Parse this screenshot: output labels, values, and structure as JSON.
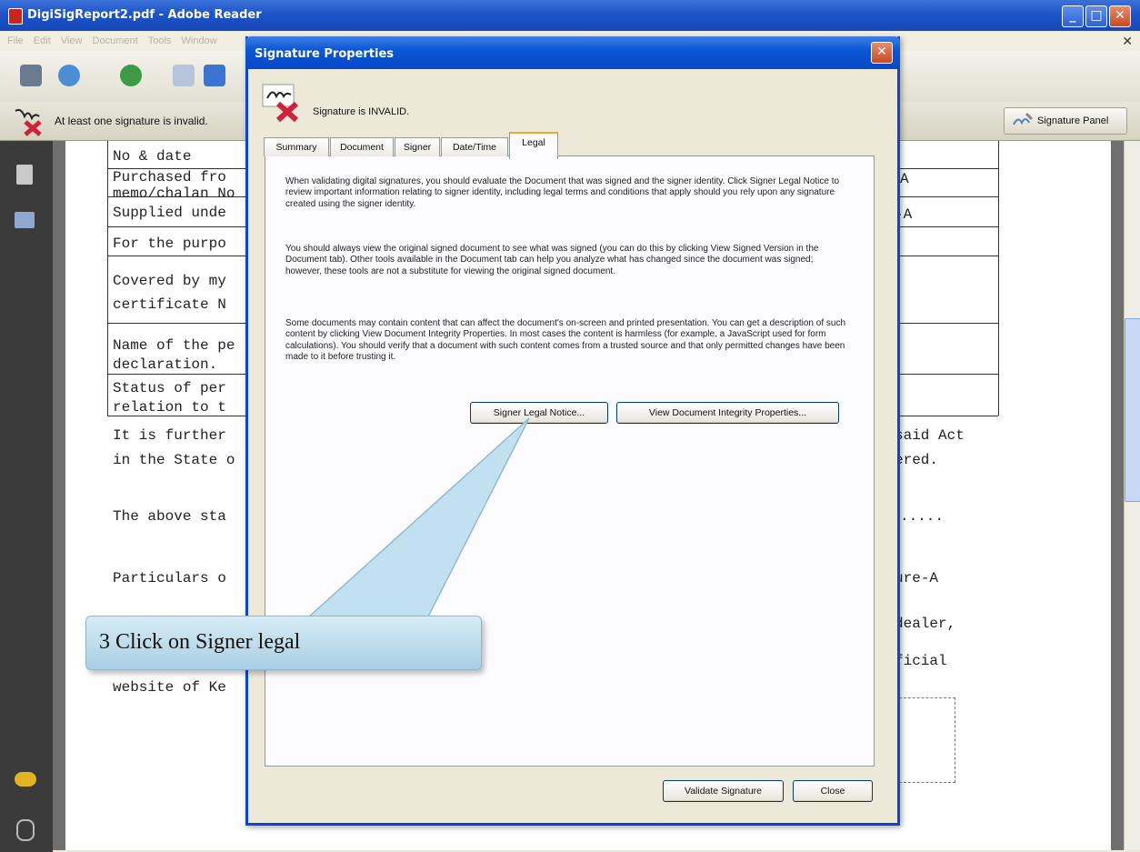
{
  "window": {
    "title": "DigiSigReport2.pdf - Adobe Reader",
    "menu": [
      "File",
      "Edit",
      "View",
      "Document",
      "Tools",
      "Window"
    ]
  },
  "sigbar": {
    "message": "At least one signature is invalid.",
    "panel_button": "Signature Panel"
  },
  "document": {
    "table_rows": [
      "No & date",
      "Purchased fro",
      "memo/chalan No",
      "Supplied unde",
      "For the purpo",
      "Covered by my",
      "certificate N",
      "Name of the pe",
      "declaration.",
      "Status of per",
      "relation to t"
    ],
    "right_fragments": [
      "A",
      "-A"
    ],
    "body_left": [
      "It is further",
      "in the State o",
      "The above sta",
      "Particulars o",
      "website of Ke"
    ],
    "body_right": [
      "said Act",
      "ered.",
      ".....",
      "ure-A",
      "dealer,",
      "ficial"
    ]
  },
  "dialog": {
    "title": "Signature Properties",
    "status": "Signature is INVALID.",
    "tabs": [
      "Summary",
      "Document",
      "Signer",
      "Date/Time",
      "Legal"
    ],
    "active_tab": "Legal",
    "paragraphs": [
      "When validating digital signatures, you should evaluate the Document that was signed and the signer identity. Click Signer Legal Notice to review important information relating to signer identity, including legal terms and conditions that apply should you rely upon any signature created using the signer identity.",
      "You should always view the original signed document to see what was signed (you can do this by clicking View Signed Version in the Document tab). Other tools available in the Document tab can help you analyze what has changed since the document was signed; however, these tools are not a substitute for viewing the original signed document.",
      "Some documents may contain content that can affect the document's on-screen and printed presentation. You can get a description of such content by clicking View Document Integrity Properties. In most cases the content is harmless (for example, a JavaScript used for form calculations). You should verify that a document with such content comes from a trusted source and that only permitted changes have been made to it before trusting it."
    ],
    "buttons": {
      "signer_legal_notice": "Signer Legal Notice...",
      "integrity_properties": "View Document Integrity Properties...",
      "validate": "Validate Signature",
      "close": "Close"
    }
  },
  "callout": {
    "text": "3 Click on Signer legal"
  },
  "colors": {
    "titlebar": "#1c54c9",
    "dialog_border": "#0a46d8",
    "invalid_red": "#d0213a",
    "callout_fill": "#bfe0f0",
    "active_tab_accent": "#f5a623"
  }
}
